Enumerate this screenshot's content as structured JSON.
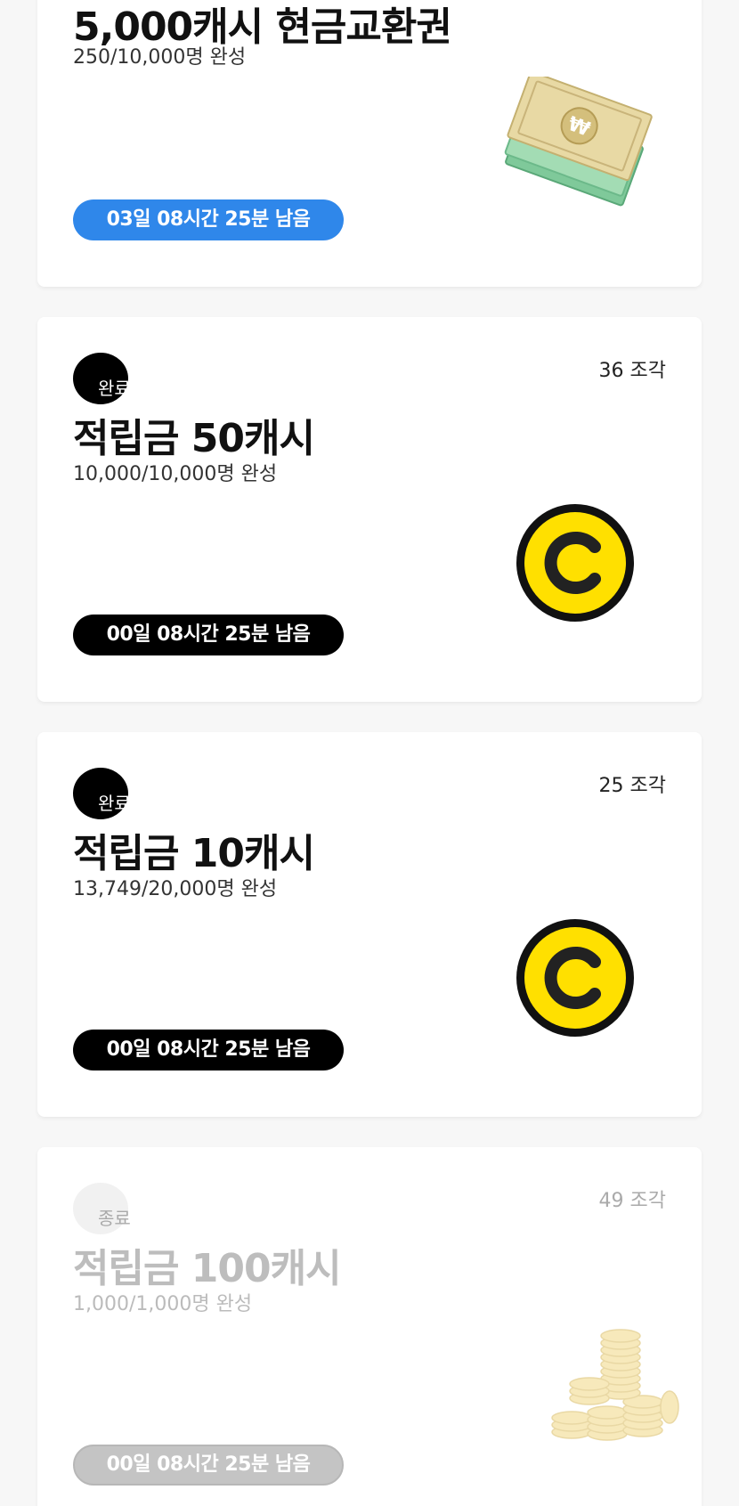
{
  "cards": [
    {
      "title": "5,000캐시 현금교환권",
      "progress": "250/10,000명 완성",
      "timer": "03일 08시간 25분 남음",
      "illustration": "banknote-won-icon",
      "timer_color": "#2f87ea"
    },
    {
      "status": "완료",
      "pieces": "36 조각",
      "title": "적립금 50캐시",
      "progress": "10,000/10,000명 완성",
      "timer": "00일 08시간 25분 남음",
      "illustration": "yellow-coin-c-icon",
      "timer_color": "#000000"
    },
    {
      "status": "완료",
      "pieces": "25 조각",
      "title": "적립금 10캐시",
      "progress": "13,749/20,000명 완성",
      "timer": "00일 08시간 25분 남음",
      "illustration": "yellow-coin-c-icon",
      "timer_color": "#000000"
    },
    {
      "status": "종료",
      "pieces": "49 조각",
      "title": "적립금 100캐시",
      "progress": "1,000/1,000명 완성",
      "timer": "00일 08시간 25분 남음",
      "illustration": "gold-coin-stacks-icon",
      "timer_color": "#c4c4c4"
    }
  ],
  "colors": {
    "background": "#f7f7f7",
    "card": "#ffffff",
    "coin_yellow": "#ffe000",
    "ended_text": "#bdbdbd"
  }
}
